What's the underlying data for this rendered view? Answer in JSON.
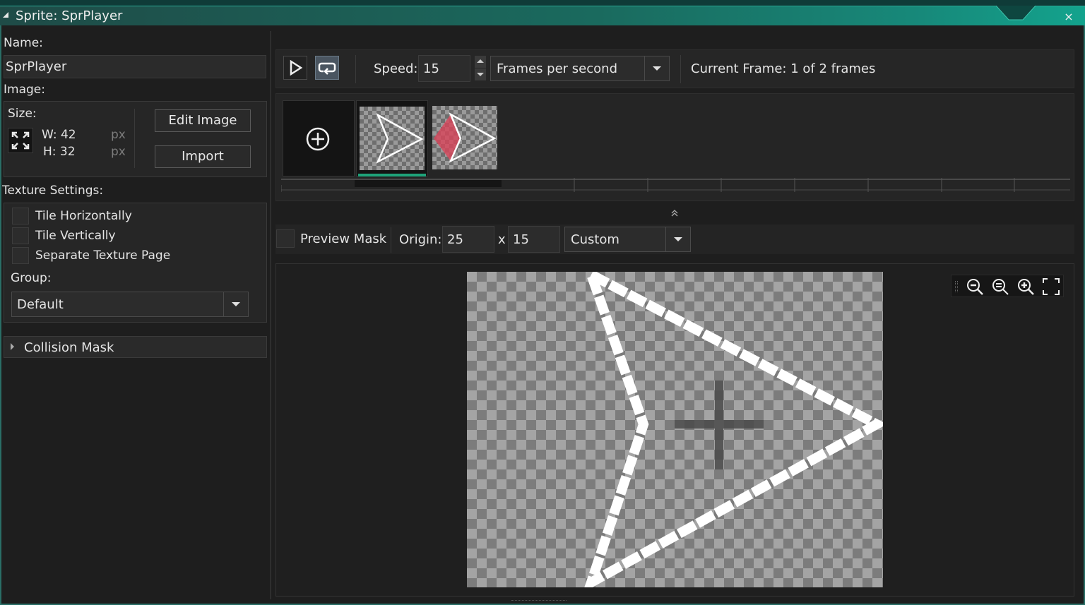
{
  "window": {
    "title": "Sprite: SprPlayer",
    "close_glyph": "×"
  },
  "left": {
    "name_label": "Name:",
    "name_value": "SprPlayer",
    "image_label": "Image:",
    "size_label": "Size:",
    "width_text": "W: 42",
    "height_text": "H: 32",
    "unit": "px",
    "edit_image_label": "Edit Image",
    "import_label": "Import",
    "texture_settings_label": "Texture Settings:",
    "tile_horizontally_label": "Tile Horizontally",
    "tile_vertically_label": "Tile Vertically",
    "separate_texture_page_label": "Separate Texture Page",
    "group_label": "Group:",
    "group_value": "Default",
    "collision_mask_label": "Collision Mask"
  },
  "toolbar": {
    "speed_label": "Speed:",
    "speed_value": "15",
    "speed_mode": "Frames per second",
    "current_frame_text": "Current Frame: 1 of 2 frames",
    "icons": [
      "play-icon",
      "loop-icon"
    ]
  },
  "frames": {
    "count": 2,
    "selected_index": 0,
    "add_icon": "add-circle-icon"
  },
  "origin": {
    "preview_mask_label": "Preview Mask",
    "origin_label": "Origin:",
    "x_value": "25",
    "separator": "x",
    "y_value": "15",
    "preset_value": "Custom"
  },
  "zoom": {
    "icons": [
      "zoom-out-icon",
      "zoom-reset-icon",
      "zoom-in-icon",
      "fit-screen-icon"
    ]
  },
  "colors": {
    "accent": "#1fa37a",
    "titlebar": "#17897a",
    "background": "#1e1e1e",
    "sprite_tint": "#d9455a"
  }
}
